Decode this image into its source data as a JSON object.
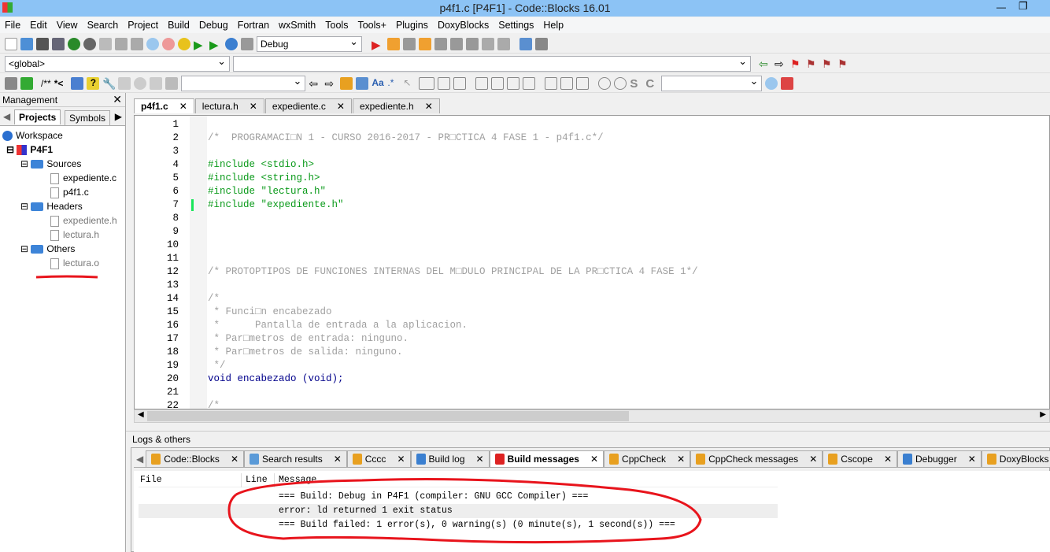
{
  "window": {
    "title": "p4f1.c [P4F1] - Code::Blocks 16.01"
  },
  "menu": [
    "File",
    "Edit",
    "View",
    "Search",
    "Project",
    "Build",
    "Debug",
    "Fortran",
    "wxSmith",
    "Tools",
    "Tools+",
    "Plugins",
    "DoxyBlocks",
    "Settings",
    "Help"
  ],
  "toolbar": {
    "build_target": "Debug",
    "scope": "<global>",
    "doxy_comment": "/**",
    "doxy_line": "*<"
  },
  "management": {
    "title": "Management",
    "tabs": [
      "Projects",
      "Symbols"
    ],
    "tree": {
      "workspace": "Workspace",
      "project": "P4F1",
      "folders": [
        {
          "name": "Sources",
          "files": [
            "expediente.c",
            "p4f1.c"
          ]
        },
        {
          "name": "Headers",
          "files": [
            "expediente.h",
            "lectura.h"
          ]
        },
        {
          "name": "Others",
          "files": [
            "lectura.o"
          ]
        }
      ]
    }
  },
  "editor": {
    "tabs": [
      "p4f1.c",
      "lectura.h",
      "expediente.c",
      "expediente.h"
    ],
    "active_tab": "p4f1.c",
    "lines": [
      {
        "n": "1",
        "t": "",
        "c": ""
      },
      {
        "n": "2",
        "t": "/*  PROGRAMACI□N 1 - CURSO 2016-2017 - PR□CTICA 4 FASE 1 - p4f1.c*/",
        "c": "cm"
      },
      {
        "n": "3",
        "t": "",
        "c": ""
      },
      {
        "n": "4",
        "t": "#include <stdio.h>",
        "c": "pp"
      },
      {
        "n": "5",
        "t": "#include <string.h>",
        "c": "pp"
      },
      {
        "n": "6",
        "t": "#include \"lectura.h\"",
        "c": "pp"
      },
      {
        "n": "7",
        "t": "#include \"expediente.h\"",
        "c": "pp"
      },
      {
        "n": "8",
        "t": "",
        "c": ""
      },
      {
        "n": "9",
        "t": "",
        "c": ""
      },
      {
        "n": "10",
        "t": "",
        "c": ""
      },
      {
        "n": "11",
        "t": "",
        "c": ""
      },
      {
        "n": "12",
        "t": "/* PROTOPTIPOS DE FUNCIONES INTERNAS DEL M□DULO PRINCIPAL DE LA PR□CTICA 4 FASE 1*/",
        "c": "cm"
      },
      {
        "n": "13",
        "t": "",
        "c": ""
      },
      {
        "n": "14",
        "t": "/*",
        "c": "cm"
      },
      {
        "n": "15",
        "t": " * Funci□n encabezado",
        "c": "cm"
      },
      {
        "n": "16",
        "t": " *      Pantalla de entrada a la aplicacion.",
        "c": "cm"
      },
      {
        "n": "17",
        "t": " * Par□metros de entrada: ninguno.",
        "c": "cm"
      },
      {
        "n": "18",
        "t": " * Par□metros de salida: ninguno.",
        "c": "cm"
      },
      {
        "n": "19",
        "t": " */",
        "c": "cm"
      },
      {
        "n": "20",
        "t": "void encabezado (void);",
        "c": "kw"
      },
      {
        "n": "21",
        "t": "",
        "c": ""
      },
      {
        "n": "22",
        "t": "/*",
        "c": "cm"
      }
    ]
  },
  "logs": {
    "title": "Logs & others",
    "tabs": [
      "Code::Blocks",
      "Search results",
      "Cccc",
      "Build log",
      "Build messages",
      "CppCheck",
      "CppCheck messages",
      "Cscope",
      "Debugger",
      "DoxyBlocks"
    ],
    "active_tab": "Build messages",
    "columns": [
      "File",
      "Line",
      "Message"
    ],
    "messages": [
      "=== Build: Debug in P4F1 (compiler: GNU GCC Compiler) ===",
      "error: ld returned 1 exit status",
      "=== Build failed: 1 error(s), 0 warning(s) (0 minute(s), 1 second(s)) ==="
    ]
  },
  "colors": {
    "annotation": "#e8141c",
    "titlebar": "#8cc3f5",
    "preprocessor": "#0a9a1a",
    "comment": "#a0a0a0"
  }
}
